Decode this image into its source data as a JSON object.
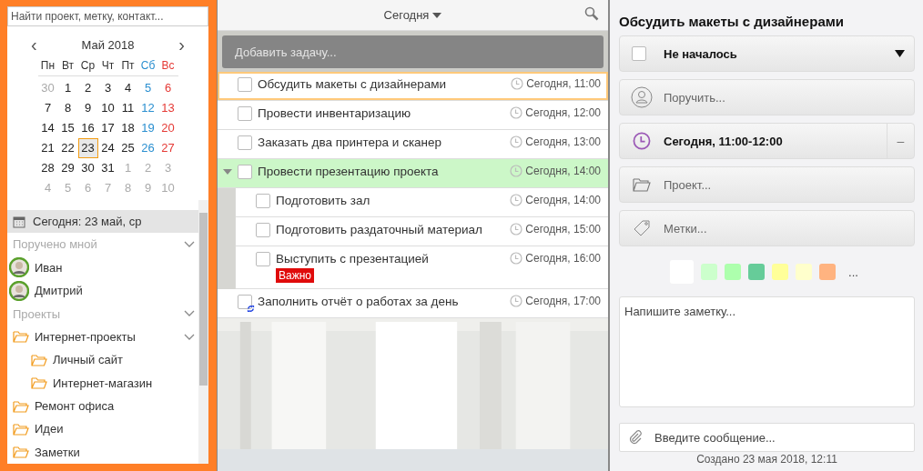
{
  "sidebar": {
    "search": {
      "placeholder": "Найти проект, метку, контакт..."
    },
    "calendar": {
      "month": "Май 2018",
      "prev": "‹",
      "next": "›",
      "weekdays": [
        {
          "label": "Пн",
          "kind": "weekday"
        },
        {
          "label": "Вт",
          "kind": "weekday"
        },
        {
          "label": "Ср",
          "kind": "weekday"
        },
        {
          "label": "Чт",
          "kind": "weekday"
        },
        {
          "label": "Пт",
          "kind": "weekday"
        },
        {
          "label": "Сб",
          "kind": "saturday"
        },
        {
          "label": "Вс",
          "kind": "sunday"
        }
      ],
      "weeks": [
        [
          {
            "day": "30",
            "muted": true,
            "selected": false
          },
          {
            "day": "1",
            "muted": false,
            "selected": false
          },
          {
            "day": "2",
            "muted": false,
            "selected": false
          },
          {
            "day": "3",
            "muted": false,
            "selected": false
          },
          {
            "day": "4",
            "muted": false,
            "selected": false
          },
          {
            "day": "5",
            "muted": false,
            "selected": false
          },
          {
            "day": "6",
            "muted": false,
            "selected": false
          }
        ],
        [
          {
            "day": "7",
            "muted": false,
            "selected": false
          },
          {
            "day": "8",
            "muted": false,
            "selected": false
          },
          {
            "day": "9",
            "muted": false,
            "selected": false
          },
          {
            "day": "10",
            "muted": false,
            "selected": false
          },
          {
            "day": "11",
            "muted": false,
            "selected": false
          },
          {
            "day": "12",
            "muted": false,
            "selected": false
          },
          {
            "day": "13",
            "muted": false,
            "selected": false
          }
        ],
        [
          {
            "day": "14",
            "muted": false,
            "selected": false
          },
          {
            "day": "15",
            "muted": false,
            "selected": false
          },
          {
            "day": "16",
            "muted": false,
            "selected": false
          },
          {
            "day": "17",
            "muted": false,
            "selected": false
          },
          {
            "day": "18",
            "muted": false,
            "selected": false
          },
          {
            "day": "19",
            "muted": false,
            "selected": false
          },
          {
            "day": "20",
            "muted": false,
            "selected": false
          }
        ],
        [
          {
            "day": "21",
            "muted": false,
            "selected": false
          },
          {
            "day": "22",
            "muted": false,
            "selected": false
          },
          {
            "day": "23",
            "muted": false,
            "selected": true
          },
          {
            "day": "24",
            "muted": false,
            "selected": false
          },
          {
            "day": "25",
            "muted": false,
            "selected": false
          },
          {
            "day": "26",
            "muted": false,
            "selected": false
          },
          {
            "day": "27",
            "muted": false,
            "selected": false
          }
        ],
        [
          {
            "day": "28",
            "muted": false,
            "selected": false
          },
          {
            "day": "29",
            "muted": false,
            "selected": false
          },
          {
            "day": "30",
            "muted": false,
            "selected": false
          },
          {
            "day": "31",
            "muted": false,
            "selected": false
          },
          {
            "day": "1",
            "muted": true,
            "selected": false
          },
          {
            "day": "2",
            "muted": true,
            "selected": false
          },
          {
            "day": "3",
            "muted": true,
            "selected": false
          }
        ],
        [
          {
            "day": "4",
            "muted": true,
            "selected": false
          },
          {
            "day": "5",
            "muted": true,
            "selected": false
          },
          {
            "day": "6",
            "muted": true,
            "selected": false
          },
          {
            "day": "7",
            "muted": true,
            "selected": false
          },
          {
            "day": "8",
            "muted": true,
            "selected": false
          },
          {
            "day": "9",
            "muted": true,
            "selected": false
          },
          {
            "day": "10",
            "muted": true,
            "selected": false
          }
        ]
      ]
    },
    "today": "Сегодня: 23 май, ср",
    "assigned": {
      "title": "Поручено мной",
      "expanded": true,
      "people": [
        {
          "name": "Иван"
        },
        {
          "name": "Дмитрий"
        }
      ]
    },
    "projects": {
      "title": "Проекты",
      "expanded": true,
      "items": [
        {
          "name": "Интернет-проекты",
          "expanded": true,
          "children": [
            {
              "name": "Личный сайт"
            },
            {
              "name": "Интернет-магазин"
            }
          ]
        },
        {
          "name": "Ремонт офиса"
        },
        {
          "name": "Идеи"
        },
        {
          "name": "Заметки"
        }
      ]
    }
  },
  "tasks_panel": {
    "filter": "Сегодня",
    "add_placeholder": "Добавить задачу...",
    "tasks": [
      {
        "title": "Обсудить макеты с дизайнерами",
        "due": "Сегодня, 11:00",
        "checked": false,
        "selected": true
      },
      {
        "title": "Провести инвентаризацию",
        "due": "Сегодня, 12:00",
        "checked": false,
        "selected": false
      },
      {
        "title": "Заказать два принтера и сканер",
        "due": "Сегодня, 13:00",
        "checked": false,
        "selected": false
      },
      {
        "title": "Провести презентацию проекта",
        "due": "Сегодня, 14:00",
        "checked": false,
        "selected": false,
        "expanded": true,
        "children": [
          {
            "title": "Подготовить зал",
            "due": "Сегодня, 14:00",
            "checked": false,
            "selected": false
          },
          {
            "title": "Подготовить раздаточный материал",
            "due": "Сегодня, 15:00",
            "checked": false,
            "selected": false
          },
          {
            "title": "Выступить с презентацией",
            "due": "Сегодня, 16:00",
            "checked": false,
            "selected": false,
            "tag": {
              "label": "Важно",
              "color": "#e00b0b"
            }
          }
        ]
      },
      {
        "title": "Заполнить отчёт о работах за день",
        "due": "Сегодня, 17:00",
        "checked": false,
        "selected": false,
        "recurring": true
      }
    ]
  },
  "details": {
    "title": "Обсудить макеты с дизайнерами",
    "status": {
      "label": "Не началось",
      "checked": false
    },
    "fields": [
      {
        "kind": "assignee",
        "text": "Поручить...",
        "filled": false
      },
      {
        "kind": "time",
        "text": "Сегодня, 11:00-12:00",
        "filled": true,
        "clear": "–"
      },
      {
        "kind": "project",
        "text": "Проект...",
        "filled": false
      },
      {
        "kind": "tags",
        "text": "Метки...",
        "filled": false
      }
    ],
    "colors": [
      {
        "color": "#ffffff",
        "selected": true
      },
      {
        "color": "#ccffcc",
        "selected": false
      },
      {
        "color": "#adffad",
        "selected": false
      },
      {
        "color": "#66cc99",
        "selected": false
      },
      {
        "color": "#ffff99",
        "selected": false
      },
      {
        "color": "#ffffcc",
        "selected": false
      },
      {
        "color": "#ffb380",
        "selected": false
      }
    ],
    "more_colors": "...",
    "note_placeholder": "Напишите заметку...",
    "message_placeholder": "Введите сообщение...",
    "created": "Создано 23 мая 2018, 12:11"
  }
}
